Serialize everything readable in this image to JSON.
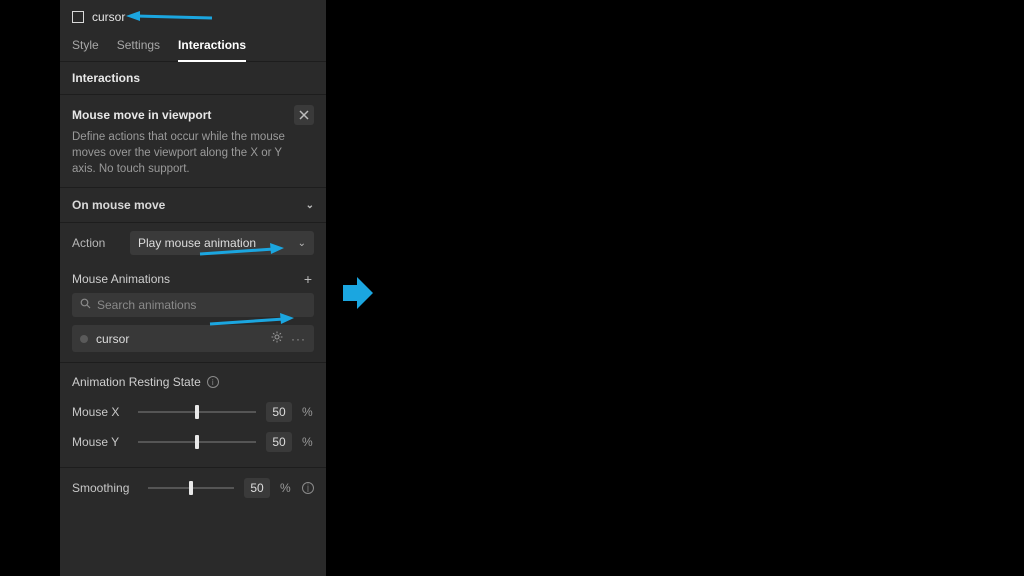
{
  "selected_element": {
    "name": "cursor"
  },
  "tabs": {
    "t0": "Style",
    "t1": "Settings",
    "t2": "Interactions",
    "active": 2
  },
  "sections": {
    "interactions_header": "Interactions",
    "trigger": {
      "title": "Mouse move in viewport",
      "desc": "Define actions that occur while the mouse moves over the viewport along the X or Y axis. No touch support."
    },
    "on_mouse_move": {
      "title": "On mouse move",
      "action_label": "Action",
      "action_value": "Play mouse animation",
      "animations_label": "Mouse Animations",
      "search_placeholder": "Search animations",
      "items": {
        "a0": {
          "name": "cursor"
        }
      },
      "resting": {
        "title": "Animation Resting State",
        "mouse_x": {
          "label": "Mouse X",
          "value": "50",
          "unit": "%"
        },
        "mouse_y": {
          "label": "Mouse Y",
          "value": "50",
          "unit": "%"
        }
      }
    },
    "smoothing": {
      "label": "Smoothing",
      "value": "50",
      "unit": "%"
    }
  },
  "colors": {
    "arrow": "#1ba6e0"
  }
}
